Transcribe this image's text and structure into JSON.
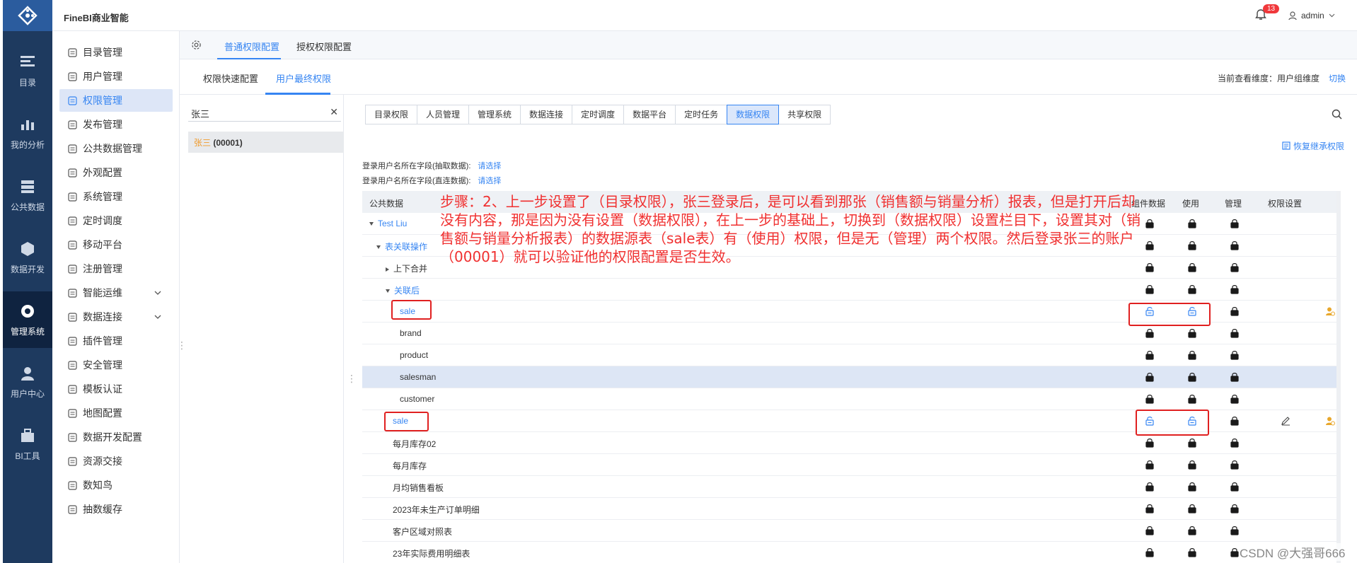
{
  "app": {
    "title": "FineBI商业智能",
    "notifications": "13",
    "user": "admin"
  },
  "rail": [
    {
      "label": "目录",
      "icon": "catalog-icon"
    },
    {
      "label": "我的分析",
      "icon": "analysis-icon"
    },
    {
      "label": "公共数据",
      "icon": "public-data-icon"
    },
    {
      "label": "数据开发",
      "icon": "data-dev-icon"
    },
    {
      "label": "管理系统",
      "icon": "admin-system-icon",
      "active": true
    },
    {
      "label": "用户中心",
      "icon": "user-center-icon"
    },
    {
      "label": "BI工具",
      "icon": "bi-tools-icon"
    }
  ],
  "menu": [
    {
      "label": "目录管理",
      "icon": "catalog-manage-icon"
    },
    {
      "label": "用户管理",
      "icon": "user-manage-icon"
    },
    {
      "label": "权限管理",
      "icon": "permission-icon",
      "active": true
    },
    {
      "label": "发布管理",
      "icon": "publish-icon"
    },
    {
      "label": "公共数据管理",
      "icon": "public-data-manage-icon"
    },
    {
      "label": "外观配置",
      "icon": "appearance-icon"
    },
    {
      "label": "系统管理",
      "icon": "system-icon"
    },
    {
      "label": "定时调度",
      "icon": "schedule-icon"
    },
    {
      "label": "移动平台",
      "icon": "mobile-icon"
    },
    {
      "label": "注册管理",
      "icon": "register-icon"
    },
    {
      "label": "智能运维",
      "icon": "ops-icon",
      "expand": true
    },
    {
      "label": "数据连接",
      "icon": "connection-icon",
      "expand": true
    },
    {
      "label": "插件管理",
      "icon": "plugin-icon"
    },
    {
      "label": "安全管理",
      "icon": "security-icon"
    },
    {
      "label": "模板认证",
      "icon": "template-icon"
    },
    {
      "label": "地图配置",
      "icon": "map-icon"
    },
    {
      "label": "数据开发配置",
      "icon": "dev-config-icon"
    },
    {
      "label": "资源交接",
      "icon": "handover-icon"
    },
    {
      "label": "数知鸟",
      "icon": "bird-icon"
    },
    {
      "label": "抽数缓存",
      "icon": "cache-icon"
    }
  ],
  "tabs1": [
    "普通权限配置",
    "授权权限配置"
  ],
  "tabs2": [
    "权限快速配置",
    "用户最终权限"
  ],
  "dimension": {
    "label": "当前查看维度：用户组维度",
    "switch": "切换"
  },
  "search": {
    "value": "张三"
  },
  "user_row": {
    "name": "张三",
    "id": "(00001)"
  },
  "perm_tabs": [
    "目录权限",
    "人员管理",
    "管理系统",
    "数据连接",
    "定时调度",
    "数据平台",
    "定时任务",
    "数据权限",
    "共享权限"
  ],
  "restore": "恢复继承权限",
  "fields": [
    {
      "label": "登录用户名所在字段(抽取数据):",
      "link": "请选择"
    },
    {
      "label": "登录用户名所在字段(直连数据):",
      "link": "请选择"
    }
  ],
  "table": {
    "headers": [
      "公共数据",
      "组件数据",
      "使用",
      "管理",
      "权限设置"
    ],
    "rows": [
      {
        "name": "Test Liu",
        "indent": 0,
        "expand": "down",
        "blue": true
      },
      {
        "name": "表关联操作",
        "indent": 1,
        "expand": "down",
        "blue": true
      },
      {
        "name": "上下合并",
        "indent": 2,
        "expand": "right"
      },
      {
        "name": "关联后",
        "indent": 2,
        "expand": "down",
        "blue": true
      },
      {
        "name": "sale",
        "indent": 3,
        "blue": true,
        "unlocked": true,
        "user_icon": true
      },
      {
        "name": "brand",
        "indent": 3
      },
      {
        "name": "product",
        "indent": 3
      },
      {
        "name": "salesman",
        "indent": 3,
        "highlight": true
      },
      {
        "name": "customer",
        "indent": 3
      },
      {
        "name": "sale",
        "indent": 2,
        "blue": true,
        "unlocked": true,
        "edit_icon": true,
        "user_icon": true
      },
      {
        "name": "每月库存02",
        "indent": 2
      },
      {
        "name": "每月库存",
        "indent": 2
      },
      {
        "name": "月均销售看板",
        "indent": 2
      },
      {
        "name": "2023年未生产订单明细",
        "indent": 2
      },
      {
        "name": "客户区域对照表",
        "indent": 2
      },
      {
        "name": "23年实际费用明细表",
        "indent": 2
      }
    ]
  },
  "annotation": "步骤：2、上一步设置了（目录权限），张三登录后，是可以看到那张（销售额与销量分析）报表，但是打开后却没有内容，那是因为没有设置（数据权限），在上一步的基础上，切换到（数据权限）设置栏目下，设置其对（销售额与销量分析报表）的数据源表（sale表）有（使用）权限，但是无（管理）两个权限。然后登录张三的账户（00001）就可以验证他的权限配置是否生效。",
  "watermark": "CSDN @大强哥666",
  "colors": {
    "accent": "#3685f2",
    "rail": "#1e3a5f",
    "annotation": "#f03030"
  }
}
